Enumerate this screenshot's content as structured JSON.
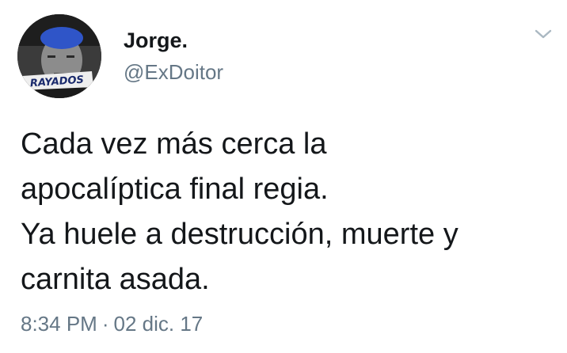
{
  "author": {
    "display_name": "Jorge.",
    "handle": "@ExDoitor",
    "avatar_badge_text": "RAYADOS"
  },
  "tweet": {
    "lines": [
      "Cada vez más cerca la",
      "apocalíptica final regia.",
      "Ya huele a destrucción, muerte y",
      "carnita asada."
    ],
    "time": "8:34 PM",
    "separator": "·",
    "date": "02 dic. 17"
  },
  "icons": {
    "menu": "chevron-down-icon"
  },
  "colors": {
    "text": "#14171a",
    "secondary": "#657786",
    "caret": "#aab8c2",
    "avatar_hair": "#2f55c8"
  }
}
